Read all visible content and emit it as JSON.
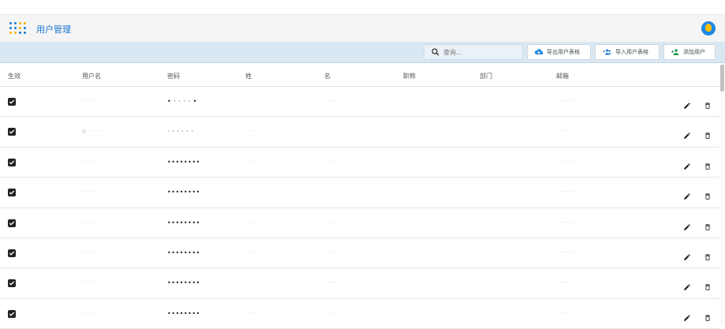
{
  "app": {
    "title": "用户管理"
  },
  "toolbar": {
    "search_placeholder": "查询...",
    "export_label": "导出用户表格",
    "import_label": "导入用户表格",
    "add_label": "添加用户"
  },
  "table": {
    "headers": [
      "生效",
      "用户名",
      "密码",
      "姓",
      "名",
      "职称",
      "部门",
      "邮箱"
    ],
    "rows": [
      {
        "enabled": true,
        "username": "· · · ·",
        "password": "• · · · · •",
        "last": "",
        "first": "· · · ·",
        "email": "· · · · · · ·"
      },
      {
        "enabled": true,
        "username": "g· · · · ·",
        "password": "· · · · · ·",
        "last": "· · ·",
        "first": "·",
        "email": "· · · · ·"
      },
      {
        "enabled": true,
        "username": "· · · ·",
        "password": "••••••••",
        "last": "· · · ·",
        "first": "· · · ·",
        "email": "· · · · · ·"
      },
      {
        "enabled": true,
        "username": "· · · · ·",
        "password": "••••••••",
        "last": "",
        "first": "",
        "email": "· · · · · · ·"
      },
      {
        "enabled": true,
        "username": "· · · · ·",
        "password": "••••••••",
        "last": "· · ·",
        "first": "· · ·",
        "email": "· · · · · · ·"
      },
      {
        "enabled": true,
        "username": "· · · · ·",
        "password": "••••••••",
        "last": "· · ·",
        "first": "· · ·",
        "email": "· · · · · · ·"
      },
      {
        "enabled": true,
        "username": "· · · ·",
        "password": "••••••••",
        "last": "·",
        "first": "· · · ·",
        "email": "· · · · ·"
      },
      {
        "enabled": true,
        "username": "· · · ·",
        "password": "••••••••",
        "last": "· · ·",
        "first": "· · ·",
        "email": "· · · ·"
      }
    ]
  },
  "colors": {
    "accent": "#1976d2",
    "toolbar_bg": "#d9e7f2",
    "appbar_bg": "#f5f5f5",
    "export_icon": "#1e88e5",
    "import_icon": "#1976d2",
    "add_icon": "#2e9e55"
  }
}
